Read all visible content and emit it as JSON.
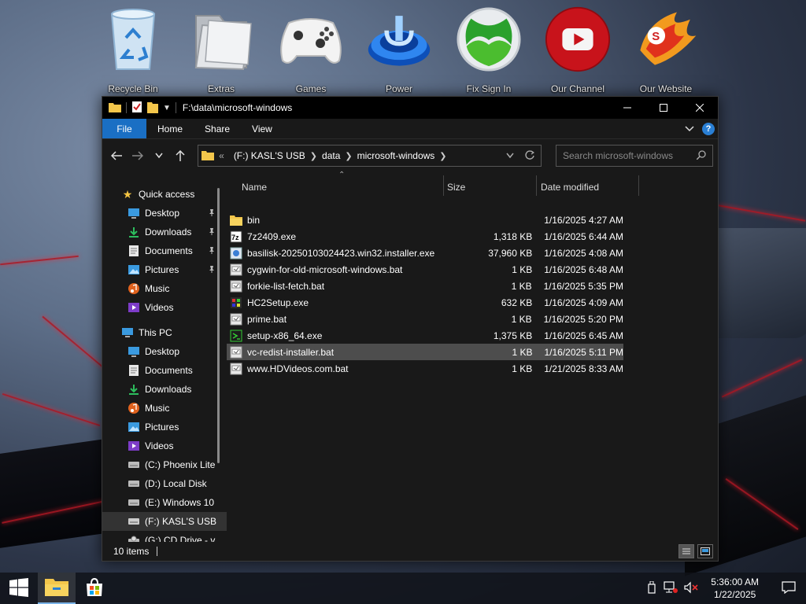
{
  "desktop": {
    "icons": [
      {
        "label": "Recycle Bin",
        "icon": "recycle-bin-icon"
      },
      {
        "label": "Extras",
        "icon": "folder-icon"
      },
      {
        "label": "Games",
        "icon": "gamepad-icon"
      },
      {
        "label": "Power",
        "icon": "power-icon"
      },
      {
        "label": "Fix Sign In",
        "icon": "xbox-icon"
      },
      {
        "label": "Our Channel",
        "icon": "youtube-icon"
      },
      {
        "label": "Our Website",
        "icon": "phoenix-icon"
      }
    ]
  },
  "window": {
    "title": "F:\\data\\microsoft-windows",
    "ribbon_tabs": [
      "File",
      "Home",
      "Share",
      "View"
    ],
    "address": {
      "prefix": "«",
      "segments": [
        "(F:) KASL'S USB",
        "data",
        "microsoft-windows"
      ]
    },
    "search": {
      "placeholder": "Search microsoft-windows"
    },
    "nav_pane": {
      "quick_access": "Quick access",
      "quick_items": [
        {
          "label": "Desktop",
          "icon": "desktop-icon",
          "pinned": true
        },
        {
          "label": "Downloads",
          "icon": "download-icon",
          "pinned": true
        },
        {
          "label": "Documents",
          "icon": "documents-icon",
          "pinned": true
        },
        {
          "label": "Pictures",
          "icon": "pictures-icon",
          "pinned": true
        },
        {
          "label": "Music",
          "icon": "music-icon",
          "pinned": false
        },
        {
          "label": "Videos",
          "icon": "videos-icon",
          "pinned": false
        }
      ],
      "this_pc": "This PC",
      "pc_items": [
        {
          "label": "Desktop",
          "icon": "desktop-icon"
        },
        {
          "label": "Documents",
          "icon": "documents-icon"
        },
        {
          "label": "Downloads",
          "icon": "download-icon"
        },
        {
          "label": "Music",
          "icon": "music-icon"
        },
        {
          "label": "Pictures",
          "icon": "pictures-icon"
        },
        {
          "label": "Videos",
          "icon": "videos-icon"
        },
        {
          "label": "(C:) Phoenix Lite",
          "icon": "drive-icon"
        },
        {
          "label": "(D:) Local Disk",
          "icon": "drive-icon"
        },
        {
          "label": "(E:) Windows 10",
          "icon": "drive-icon"
        },
        {
          "label": "(F:) KASL'S USB",
          "icon": "usb-drive-icon"
        },
        {
          "label": "(G:) CD Drive - v",
          "icon": "cd-drive-icon"
        }
      ]
    },
    "columns": {
      "name": "Name",
      "size": "Size",
      "date": "Date modified"
    },
    "files": [
      {
        "name": "bin",
        "size": "",
        "date": "1/16/2025 4:27 AM",
        "icon": "folder-icon"
      },
      {
        "name": "7z2409.exe",
        "size": "1,318 KB",
        "date": "1/16/2025 6:44 AM",
        "icon": "7zip-icon"
      },
      {
        "name": "basilisk-20250103024423.win32.installer.exe",
        "size": "37,960 KB",
        "date": "1/16/2025 4:08 AM",
        "icon": "installer-icon"
      },
      {
        "name": "cygwin-for-old-microsoft-windows.bat",
        "size": "1 KB",
        "date": "1/16/2025 6:48 AM",
        "icon": "bat-file-icon"
      },
      {
        "name": "forkie-list-fetch.bat",
        "size": "1 KB",
        "date": "1/16/2025 5:35 PM",
        "icon": "bat-file-icon"
      },
      {
        "name": "HC2Setup.exe",
        "size": "632 KB",
        "date": "1/16/2025 4:09 AM",
        "icon": "setup-icon"
      },
      {
        "name": "prime.bat",
        "size": "1 KB",
        "date": "1/16/2025 5:20 PM",
        "icon": "bat-file-icon"
      },
      {
        "name": "setup-x86_64.exe",
        "size": "1,375 KB",
        "date": "1/16/2025 6:45 AM",
        "icon": "cygwin-setup-icon"
      },
      {
        "name": "vc-redist-installer.bat",
        "size": "1 KB",
        "date": "1/16/2025 5:11 PM",
        "icon": "bat-file-icon",
        "highlighted": true
      },
      {
        "name": "www.HDVideos.com.bat",
        "size": "1 KB",
        "date": "1/21/2025 8:33 AM",
        "icon": "bat-file-icon"
      }
    ],
    "status": "10 items"
  },
  "taskbar": {
    "time": "5:36:00 AM",
    "date": "1/22/2025"
  },
  "colors": {
    "accent": "#1a6fc4",
    "window_bg": "#191919",
    "highlight_row": "#4d4d4d"
  }
}
